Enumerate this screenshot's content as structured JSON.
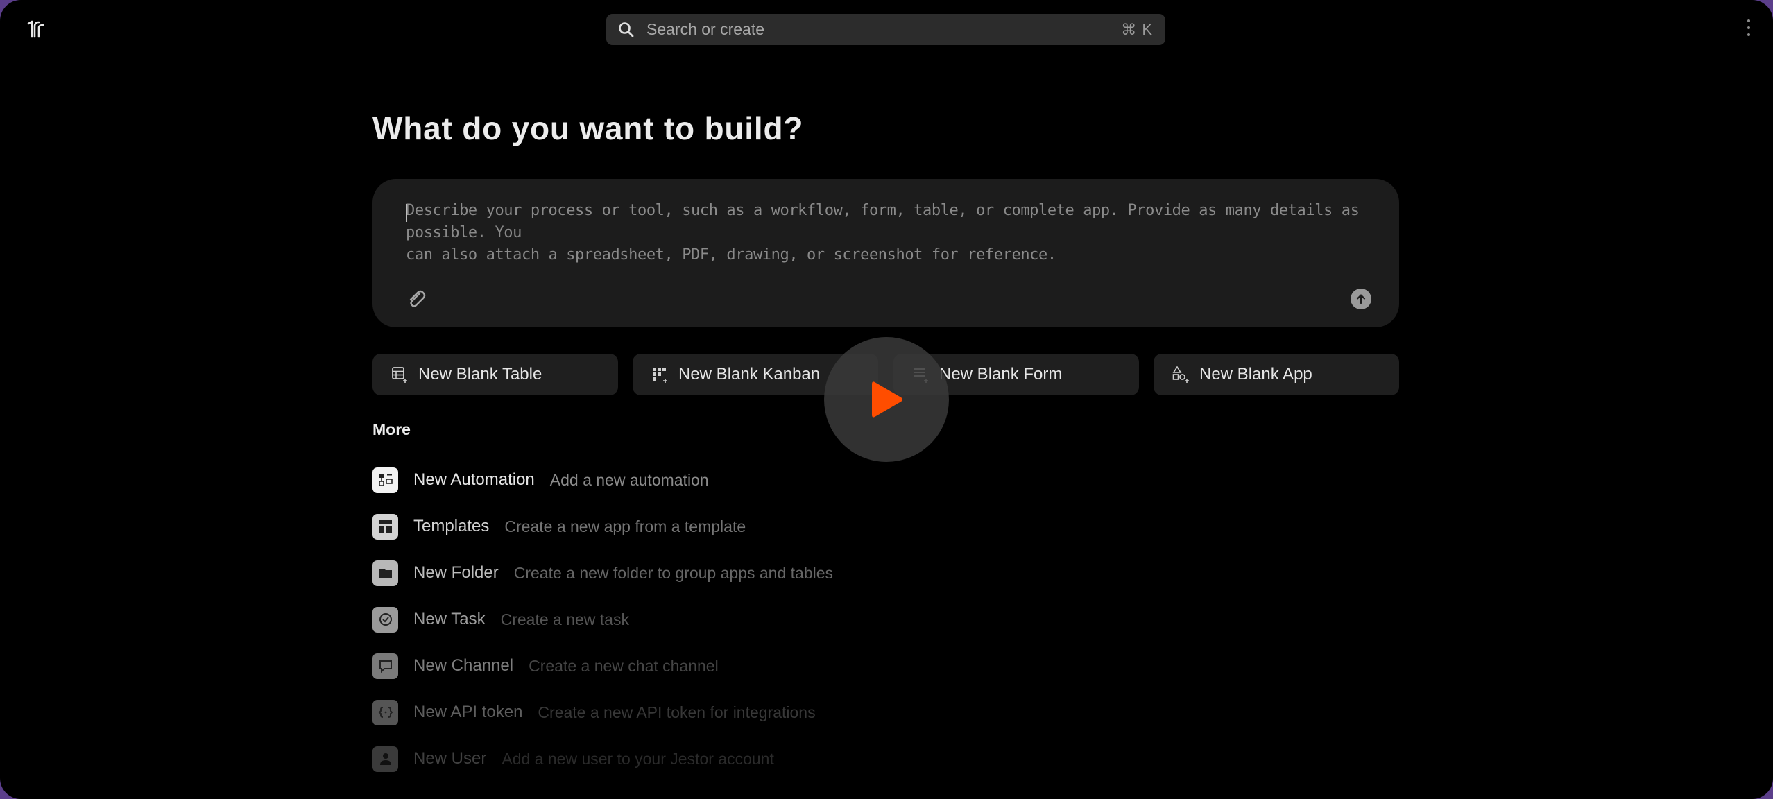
{
  "topbar": {
    "search_placeholder": "Search or create",
    "shortcut": "⌘ K"
  },
  "main": {
    "heading": "What do you want to build?",
    "prompt_placeholder_line1": "Describe your process or tool, such as a workflow, form, table, or complete app. Provide as many details as possible. You",
    "prompt_placeholder_line2": "can also attach a spreadsheet, PDF, drawing, or screenshot for reference."
  },
  "blank_buttons": [
    {
      "label": "New Blank Table",
      "icon": "table-icon"
    },
    {
      "label": "New Blank Kanban",
      "icon": "kanban-icon"
    },
    {
      "label": "New Blank Form",
      "icon": "form-icon"
    },
    {
      "label": "New Blank App",
      "icon": "app-icon"
    }
  ],
  "more": {
    "title": "More",
    "items": [
      {
        "title": "New Automation",
        "desc": "Add a new automation",
        "icon": "automation-icon"
      },
      {
        "title": "Templates",
        "desc": "Create a new app from a template",
        "icon": "templates-icon"
      },
      {
        "title": "New Folder",
        "desc": "Create a new folder to group apps and tables",
        "icon": "folder-icon"
      },
      {
        "title": "New Task",
        "desc": "Create a new task",
        "icon": "task-icon"
      },
      {
        "title": "New Channel",
        "desc": "Create a new chat channel",
        "icon": "channel-icon"
      },
      {
        "title": "New API token",
        "desc": "Create a new API token for integrations",
        "icon": "api-token-icon"
      },
      {
        "title": "New User",
        "desc": "Add a new user to your Jestor account",
        "icon": "user-icon"
      }
    ]
  },
  "colors": {
    "accent_play": "#ff4d00",
    "background": "#000000",
    "panel": "#1c1c1c"
  }
}
